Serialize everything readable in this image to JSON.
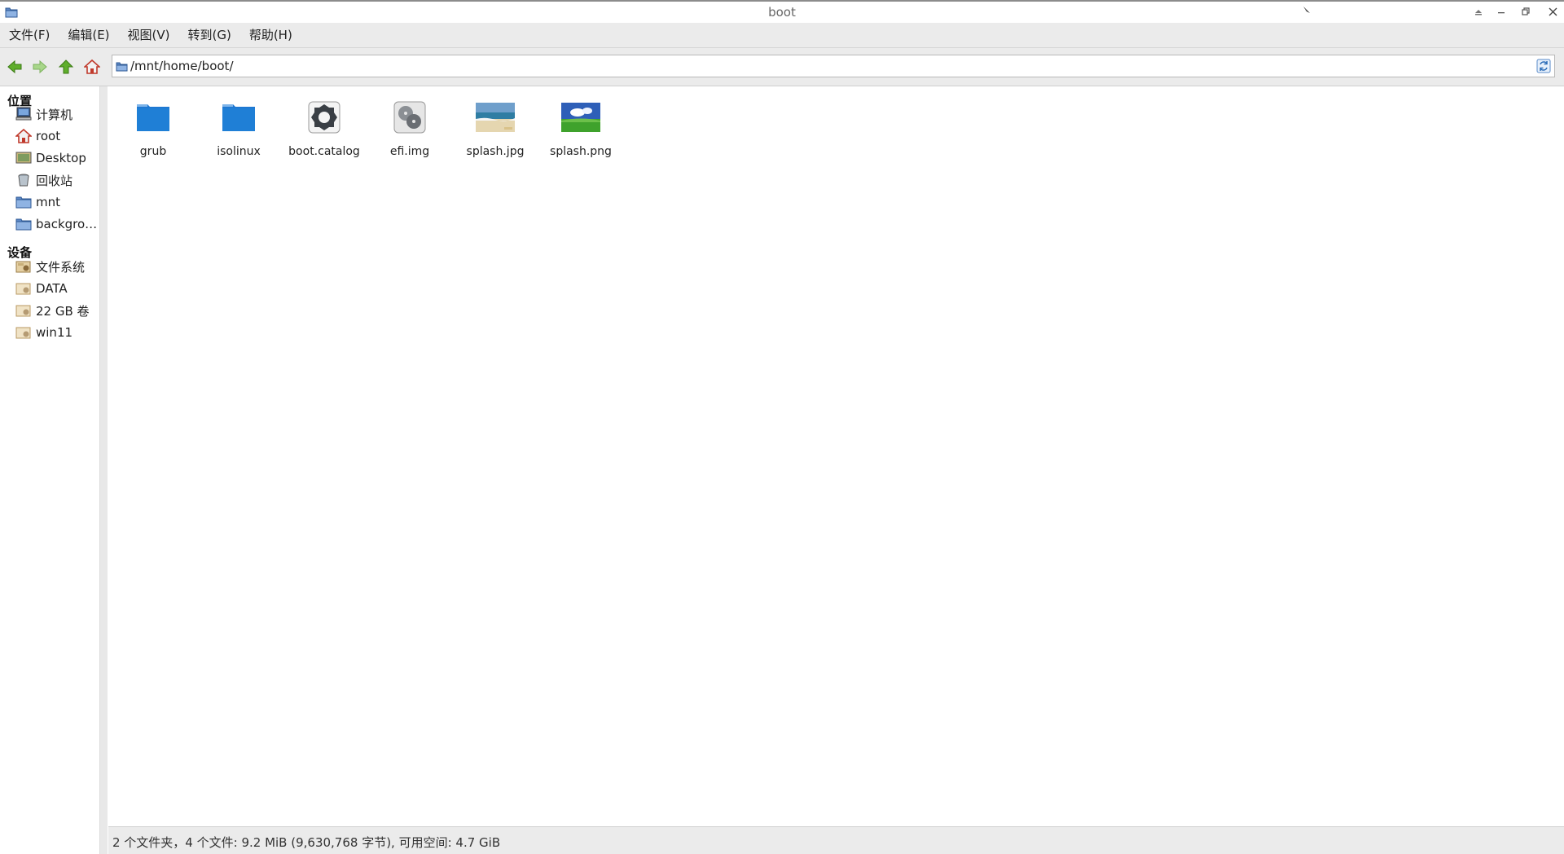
{
  "window": {
    "title": "boot"
  },
  "menubar": {
    "items": [
      "文件(F)",
      "编辑(E)",
      "视图(V)",
      "转到(G)",
      "帮助(H)"
    ]
  },
  "toolbar": {
    "back_icon": "back-arrow-icon",
    "forward_icon": "forward-arrow-icon",
    "up_icon": "up-arrow-icon",
    "home_icon": "home-icon",
    "address_value": "/mnt/home/boot/"
  },
  "sidebar": {
    "places_header": "位置",
    "places": [
      {
        "label": "计算机",
        "icon": "computer-icon"
      },
      {
        "label": "root",
        "icon": "home-icon"
      },
      {
        "label": "Desktop",
        "icon": "desktop-icon"
      },
      {
        "label": "回收站",
        "icon": "trash-icon"
      },
      {
        "label": "mnt",
        "icon": "folder-icon"
      },
      {
        "label": "backgro…",
        "icon": "folder-icon"
      }
    ],
    "devices_header": "设备",
    "devices": [
      {
        "label": "文件系统",
        "icon": "drive-icon"
      },
      {
        "label": "DATA",
        "icon": "drive-icon"
      },
      {
        "label": "22 GB 卷",
        "icon": "drive-icon"
      },
      {
        "label": "win11",
        "icon": "drive-icon"
      }
    ]
  },
  "files": [
    {
      "name": "grub",
      "icon": "folder-icon"
    },
    {
      "name": "isolinux",
      "icon": "folder-icon"
    },
    {
      "name": "boot.catalog",
      "icon": "gear-file-icon"
    },
    {
      "name": "efi.img",
      "icon": "disk-image-icon"
    },
    {
      "name": "splash.jpg",
      "icon": "image-beach-icon"
    },
    {
      "name": "splash.png",
      "icon": "image-landscape-icon"
    }
  ],
  "statusbar": {
    "text": "2 个文件夹，4 个文件: 9.2 MiB (9,630,768 字节), 可用空间: 4.7 GiB"
  },
  "colors": {
    "folder_blue": "#1f7fd6",
    "menubar_bg": "#ebebeb",
    "title_text": "#666666"
  }
}
